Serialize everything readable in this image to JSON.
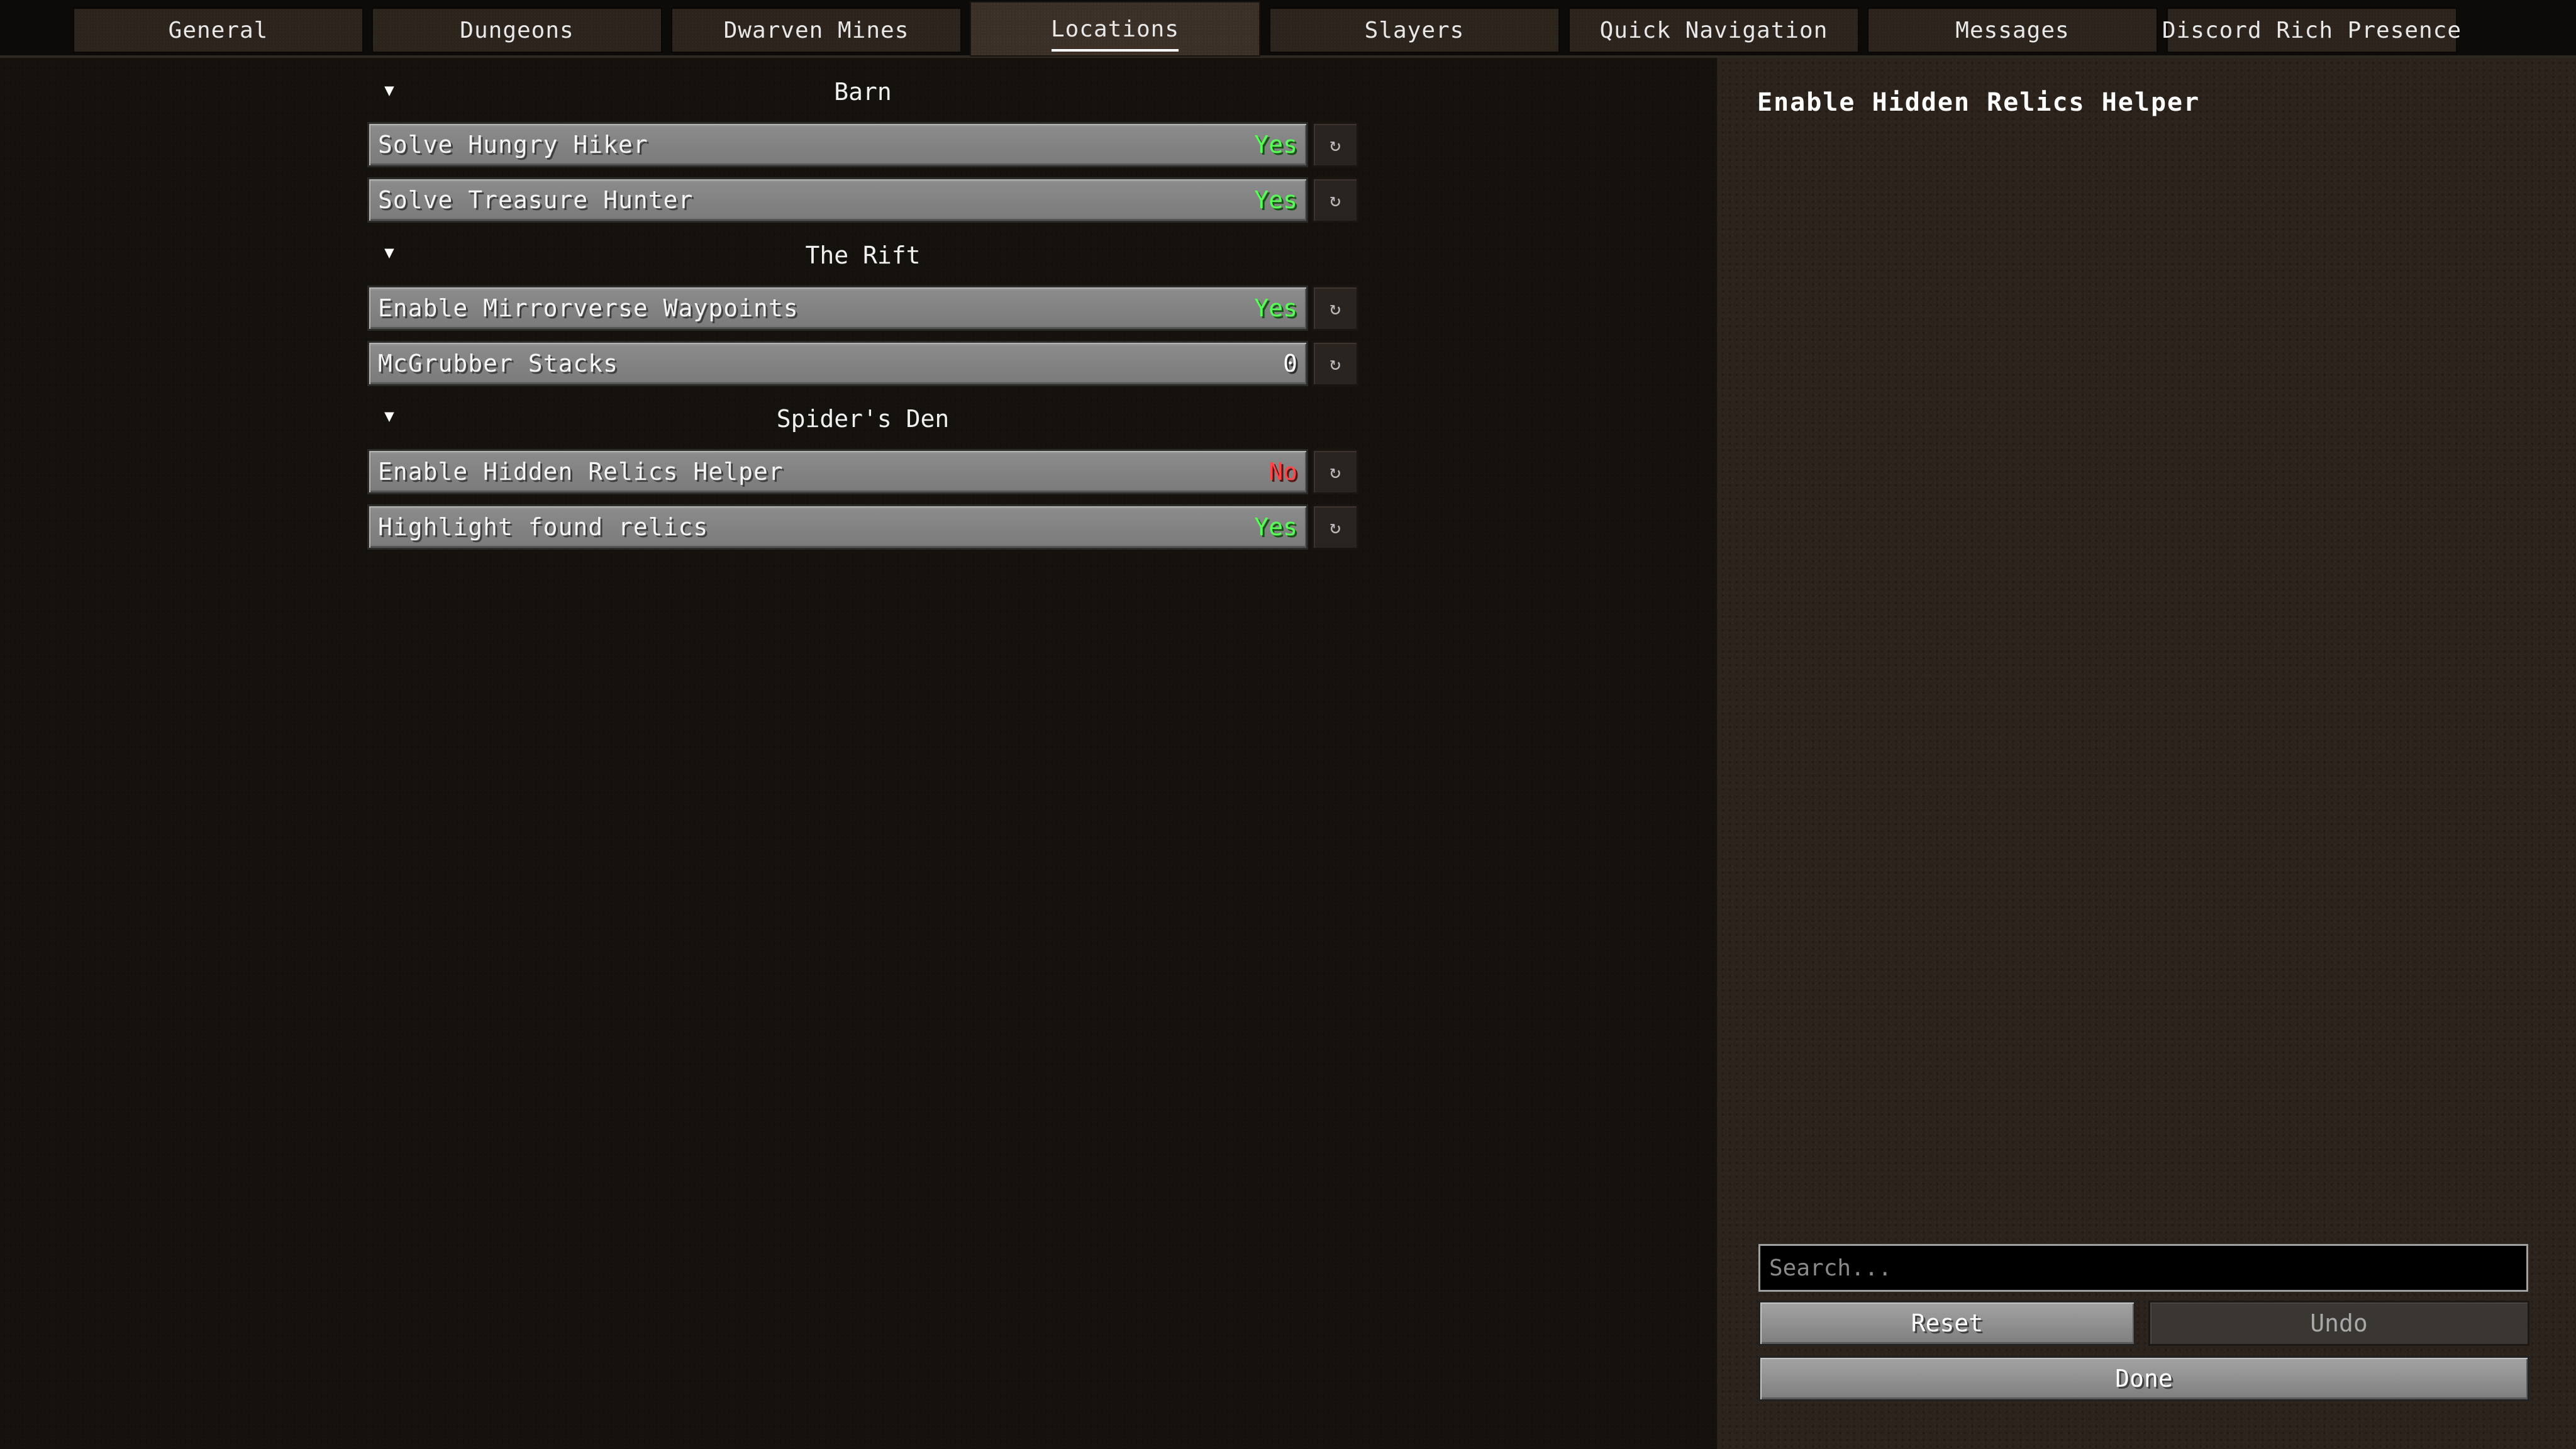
{
  "tabs": [
    {
      "label": "General",
      "active": false
    },
    {
      "label": "Dungeons",
      "active": false
    },
    {
      "label": "Dwarven Mines",
      "active": false
    },
    {
      "label": "Locations",
      "active": true
    },
    {
      "label": "Slayers",
      "active": false
    },
    {
      "label": "Quick Navigation",
      "active": false
    },
    {
      "label": "Messages",
      "active": false
    },
    {
      "label": "Discord Rich Presence",
      "active": false
    }
  ],
  "sections": [
    {
      "title": "Barn",
      "toggle_icon": "triangle-down",
      "options": [
        {
          "label": "Solve Hungry Hiker",
          "value": "Yes"
        },
        {
          "label": "Solve Treasure Hunter",
          "value": "Yes"
        }
      ]
    },
    {
      "title": "The Rift",
      "toggle_icon": "triangle-down",
      "options": [
        {
          "label": "Enable Mirrorverse Waypoints",
          "value": "Yes"
        },
        {
          "label": "McGrubber Stacks",
          "value": "0"
        }
      ]
    },
    {
      "title": "Spider's Den",
      "toggle_icon": "triangle-down",
      "options": [
        {
          "label": "Enable Hidden Relics Helper",
          "value": "No"
        },
        {
          "label": "Highlight found relics",
          "value": "Yes"
        }
      ]
    }
  ],
  "reset_icon": "↻",
  "description": {
    "title": "Enable Hidden Relics Helper"
  },
  "search": {
    "placeholder": "Search...",
    "value": ""
  },
  "buttons": {
    "reset": "Reset",
    "undo": "Undo",
    "done": "Done"
  },
  "colors": {
    "yes": "#55ff55",
    "no": "#ff4545",
    "accent_underline": "#ffffff"
  }
}
